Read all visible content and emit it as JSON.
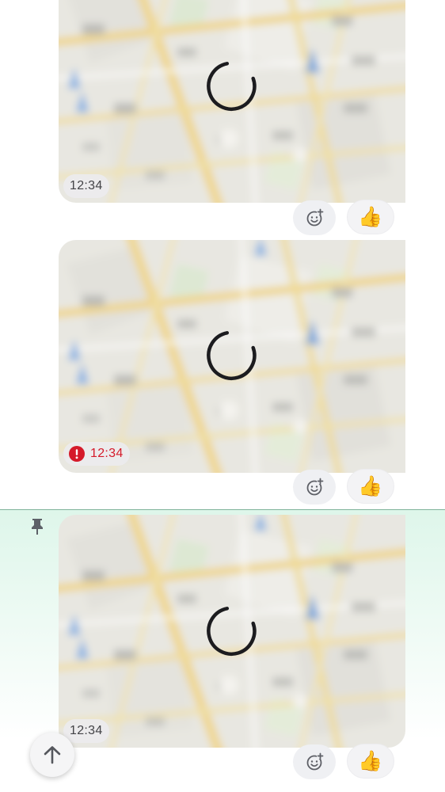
{
  "messages": [
    {
      "time": "12:34",
      "status": "sent",
      "reactions": {
        "add_icon": "add-reaction-icon",
        "like_emoji": "👍"
      }
    },
    {
      "time": "12:34",
      "status": "error",
      "reactions": {
        "add_icon": "add-reaction-icon",
        "like_emoji": "👍"
      }
    },
    {
      "time": "12:34",
      "status": "pinned",
      "reactions": {
        "add_icon": "add-reaction-icon",
        "like_emoji": "👍"
      }
    }
  ],
  "colors": {
    "error": "#d51a2a",
    "pinned_background": "#def6ea",
    "map_base": "#e9e8e2",
    "map_road": "#efd98c",
    "map_marker": "#8bb4e0",
    "spinner": "#1c1c1f"
  },
  "icons": {
    "pin": "pin-icon",
    "error": "error-icon",
    "loading": "loading-spinner-icon",
    "scroll_up": "arrow-up-icon"
  }
}
